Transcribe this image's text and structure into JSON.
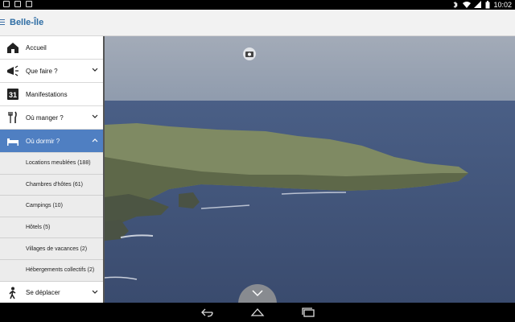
{
  "status": {
    "time": "10:02"
  },
  "app": {
    "title": "Belle-Île"
  },
  "nav": {
    "items": [
      {
        "label": "Accueil"
      },
      {
        "label": "Que faire ?"
      },
      {
        "label": "Manifestations",
        "badge": "31"
      },
      {
        "label": "Où manger ?"
      },
      {
        "label": "Où dormir ?"
      },
      {
        "label": "Se déplacer"
      }
    ],
    "sub": [
      {
        "label": "Locations meublées (188)"
      },
      {
        "label": "Chambres d'hôtes (61)"
      },
      {
        "label": "Campings (10)"
      },
      {
        "label": "Hôtels (5)"
      },
      {
        "label": "Villages de vacances (2)"
      },
      {
        "label": "Hébergements collectifs (2)"
      }
    ]
  },
  "colors": {
    "accent": "#4f7fc2",
    "title": "#2e6da4",
    "sea": "#3d4f72"
  }
}
